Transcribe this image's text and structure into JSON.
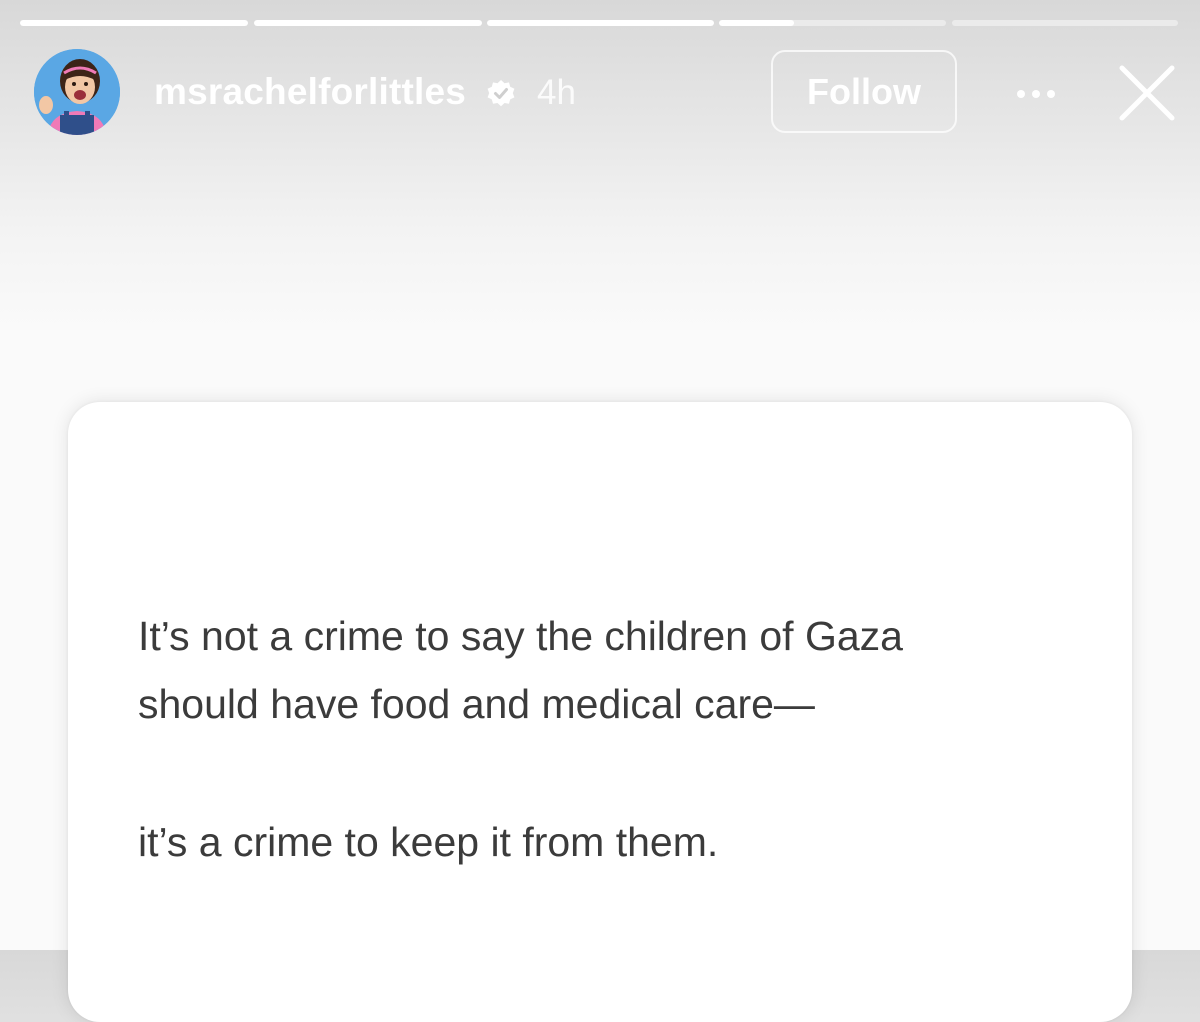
{
  "story": {
    "progress_segments": [
      1.0,
      1.0,
      1.0,
      0.33,
      0.0,
      0.0
    ],
    "header": {
      "username": "msrachelforlittles",
      "verified": true,
      "timestamp": "4h",
      "follow_label": "Follow",
      "icons": {
        "avatar": "profile-photo",
        "verified": "verified-badge-icon",
        "more": "more-options-icon",
        "close": "close-icon"
      }
    },
    "post": {
      "lines": [
        "It’s not a crime to say the children of Gaza",
        "should have food and medical care—",
        "it’s a crime to keep it from them."
      ]
    }
  },
  "colors": {
    "header_text": "#ffffff",
    "post_text": "#3b3b3b",
    "card_background": "#ffffff",
    "avatar_background": "#5aa7e4"
  }
}
